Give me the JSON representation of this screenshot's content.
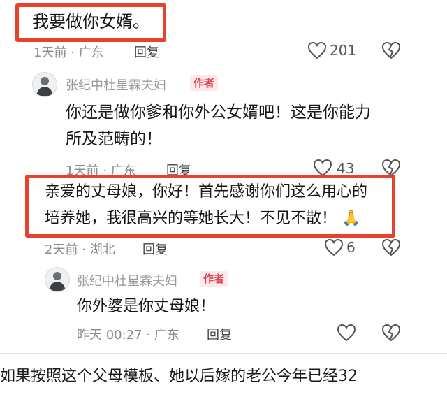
{
  "comment1": {
    "text": "我要做你女婿。",
    "time": "1天前",
    "sep": "·",
    "location": "广东",
    "reply_label": "回复",
    "likes": "201"
  },
  "reply1": {
    "author": "张纪中杜星霖夫妇",
    "badge": "作者",
    "line1": "你还是做你爹和你外公女婿吧！这是你能力",
    "line2": "所及范畴的！",
    "time": "1天前",
    "sep": "·",
    "location": "广东",
    "reply_label": "回复",
    "likes": "43"
  },
  "comment2": {
    "line1": "亲爱的丈母娘，你好！首先感谢你们这么用心的",
    "line2": "培养她，我很高兴的等她长大！不见不散！",
    "emoji": "🙏",
    "time": "2天前",
    "sep": "·",
    "location": "湖北",
    "reply_label": "回复",
    "likes": "6"
  },
  "reply2": {
    "author": "张纪中杜星霖夫妇",
    "badge": "作者",
    "text": "你外婆是你丈母娘！",
    "time": "昨天 00:27",
    "sep": "·",
    "location": "广东",
    "reply_label": "回复",
    "likes": ""
  },
  "footer": {
    "line1": "如果按照这个父母模板、她以后嫁的老公今年已经32"
  },
  "colors": {
    "highlight": "#e8412c",
    "badge_text": "#e0404f",
    "badge_bg": "#fde8ea"
  },
  "icons": [
    "heart-icon",
    "broken-heart-icon",
    "avatar-icon",
    "folded-hands-emoji"
  ]
}
